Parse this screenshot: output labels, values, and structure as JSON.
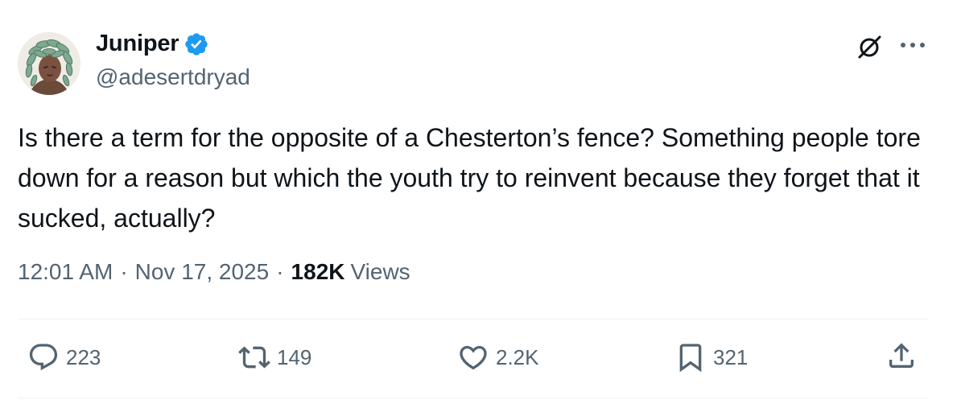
{
  "author": {
    "display_name": "Juniper",
    "handle": "@adesertdryad",
    "verified": true,
    "avatar_icon": "avatar-illustration"
  },
  "header_icons": [
    "grok-icon",
    "more-icon"
  ],
  "tweet": {
    "text": "Is there a term for the opposite of a Chesterton’s fence? Something people tore down for a reason but which the youth try to reinvent because they forget that it sucked, actually?",
    "time": "12:01 AM",
    "date": "Nov 17, 2025",
    "separator": "·",
    "views_count": "182K",
    "views_label": "Views"
  },
  "actions": {
    "replies": "223",
    "reposts": "149",
    "likes": "2.2K",
    "bookmarks": "321"
  },
  "colors": {
    "text": "#0f1419",
    "secondary": "#536471",
    "verified": "#1d9bf0",
    "divider": "#eff3f4"
  }
}
